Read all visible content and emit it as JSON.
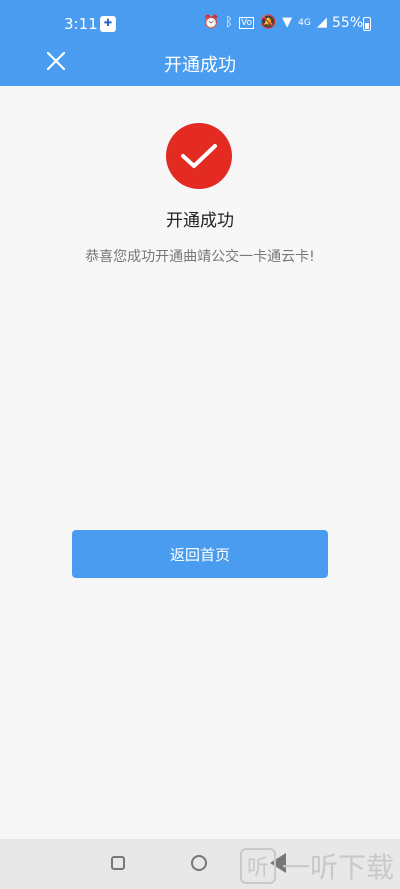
{
  "status_bar": {
    "time": "3:11",
    "battery": "55%",
    "network": "4G",
    "icons": [
      "app-icon",
      "alarm-icon",
      "bluetooth-icon",
      "volte-icon",
      "mute-icon",
      "wifi-icon",
      "signal-icon",
      "battery-icon"
    ],
    "background": "#4a9cf0"
  },
  "nav": {
    "title": "开通成功"
  },
  "success": {
    "title": "开通成功",
    "message": "恭喜您成功开通曲靖公交一卡通云卡!",
    "icon_color": "#e32b22"
  },
  "actions": {
    "home_button_label": "返回首页"
  },
  "watermark": {
    "logo_text": "听",
    "text": "一听下载"
  },
  "colors": {
    "accent": "#4a9cf0",
    "page_bg": "#f7f7f7"
  }
}
